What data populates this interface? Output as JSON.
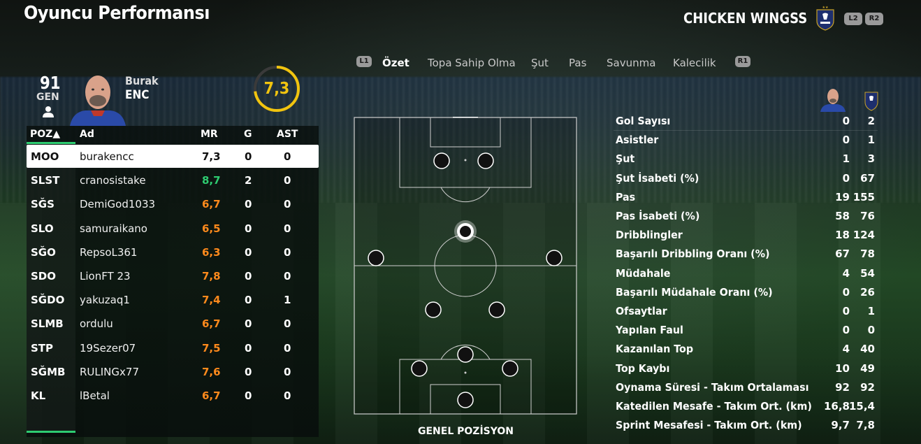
{
  "page": {
    "title": "Oyuncu Performansı"
  },
  "team": {
    "name": "CHICKEN WINGSS",
    "crest_icon": "france-fff-crest-icon",
    "l2": "L2",
    "r2": "R2"
  },
  "player": {
    "overall": "91",
    "overall_label": "GEN",
    "first_name": "Burak",
    "last_name": "ENC",
    "match_rating": "7,3"
  },
  "table": {
    "headers": {
      "pos": "POZ▲",
      "name": "Ad",
      "mr": "MR",
      "g": "G",
      "ast": "AST"
    },
    "rows": [
      {
        "pos": "MOO",
        "name": "burakencc",
        "mr": "7,3",
        "g": "0",
        "ast": "0",
        "color": "white"
      },
      {
        "pos": "SLST",
        "name": "cranosistake",
        "mr": "8,7",
        "g": "2",
        "ast": "0",
        "color": "green"
      },
      {
        "pos": "SĞS",
        "name": "DemiGod1033",
        "mr": "6,7",
        "g": "0",
        "ast": "0",
        "color": "orange"
      },
      {
        "pos": "SLO",
        "name": "samuraikano",
        "mr": "6,5",
        "g": "0",
        "ast": "0",
        "color": "orange"
      },
      {
        "pos": "SĞO",
        "name": "RepsoL361",
        "mr": "6,3",
        "g": "0",
        "ast": "0",
        "color": "orange"
      },
      {
        "pos": "SDO",
        "name": "LionFT 23",
        "mr": "7,8",
        "g": "0",
        "ast": "0",
        "color": "orange"
      },
      {
        "pos": "SĞDO",
        "name": "yakuzaq1",
        "mr": "7,4",
        "g": "0",
        "ast": "1",
        "color": "orange"
      },
      {
        "pos": "SLMB",
        "name": "ordulu",
        "mr": "6,7",
        "g": "0",
        "ast": "0",
        "color": "orange"
      },
      {
        "pos": "STP",
        "name": "19Sezer07",
        "mr": "7,5",
        "g": "0",
        "ast": "0",
        "color": "orange"
      },
      {
        "pos": "SĞMB",
        "name": "RULINGx77",
        "mr": "7,6",
        "g": "0",
        "ast": "0",
        "color": "orange"
      },
      {
        "pos": "KL",
        "name": "lBetal",
        "mr": "6,7",
        "g": "0",
        "ast": "0",
        "color": "orange"
      }
    ]
  },
  "tabs": {
    "l1": "L1",
    "r1": "R1",
    "items": [
      "Özet",
      "Topa Sahip Olma",
      "Şut",
      "Pas",
      "Savunma",
      "Kalecilik"
    ],
    "active": "Özet"
  },
  "pitch": {
    "label": "GENEL POZİSYON"
  },
  "stats": {
    "rows": [
      {
        "label": "Gol Sayısı",
        "player": "0",
        "team": "2"
      },
      {
        "label": "Asistler",
        "player": "0",
        "team": "1"
      },
      {
        "label": "Şut",
        "player": "1",
        "team": "3"
      },
      {
        "label": "Şut İsabeti (%)",
        "player": "0",
        "team": "67"
      },
      {
        "label": "Pas",
        "player": "19",
        "team": "155"
      },
      {
        "label": "Pas İsabeti (%)",
        "player": "58",
        "team": "76"
      },
      {
        "label": "Dribblingler",
        "player": "18",
        "team": "124"
      },
      {
        "label": "Başarılı Dribbling Oranı (%)",
        "player": "67",
        "team": "78"
      },
      {
        "label": "Müdahale",
        "player": "4",
        "team": "54"
      },
      {
        "label": "Başarılı Müdahale Oranı (%)",
        "player": "0",
        "team": "26"
      },
      {
        "label": "Ofsaytlar",
        "player": "0",
        "team": "1"
      },
      {
        "label": "Yapılan Faul",
        "player": "0",
        "team": "0"
      },
      {
        "label": "Kazanılan Top",
        "player": "4",
        "team": "40"
      },
      {
        "label": "Top Kaybı",
        "player": "10",
        "team": "49"
      },
      {
        "label": "Oynama Süresi - Takım Ortalaması",
        "player": "92",
        "team": "92"
      },
      {
        "label": "Katedilen Mesafe - Takım Ort. (km)",
        "player": "16,8",
        "team": "15,4"
      },
      {
        "label": "Sprint Mesafesi - Takım Ort. (km)",
        "player": "9,7",
        "team": "7,8"
      }
    ]
  }
}
